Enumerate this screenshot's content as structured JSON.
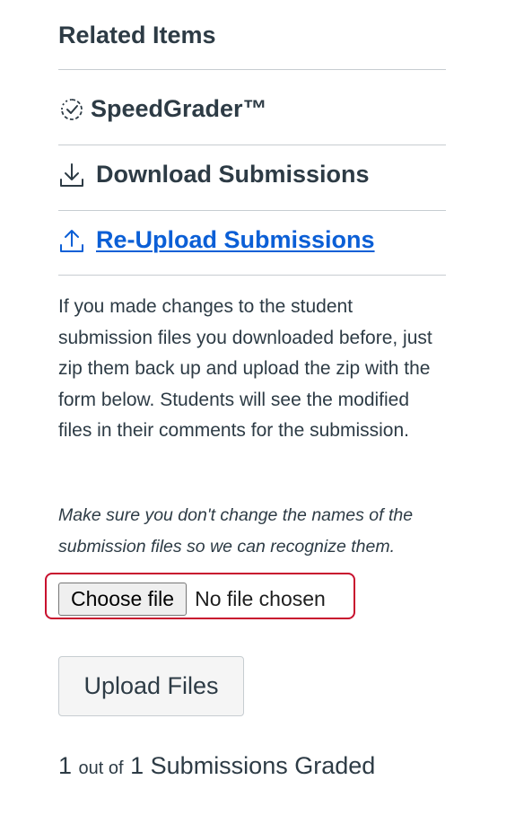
{
  "related": {
    "title": "Related Items",
    "items": [
      {
        "label": "SpeedGrader™",
        "icon": "speedgrader-icon"
      },
      {
        "label": "Download Submissions",
        "icon": "download-icon"
      },
      {
        "label": "Re-Upload Submissions",
        "icon": "upload-icon",
        "color": "#0b5fd6"
      }
    ]
  },
  "reupload": {
    "description": "If you made changes to the student submission files you downloaded before, just zip them back up and upload the zip with the form below. Students will see the modified files in their comments for the submission.",
    "note": "Make sure you don't change the names of the submission files so we can recognize them.",
    "file_input": {
      "button_label": "Choose file",
      "status": "No file chosen",
      "highlight_color": "#c8102e"
    },
    "upload_button_label": "Upload Files"
  },
  "grading": {
    "graded": "1",
    "out_of": "out of",
    "total": "1",
    "suffix": "Submissions Graded"
  }
}
